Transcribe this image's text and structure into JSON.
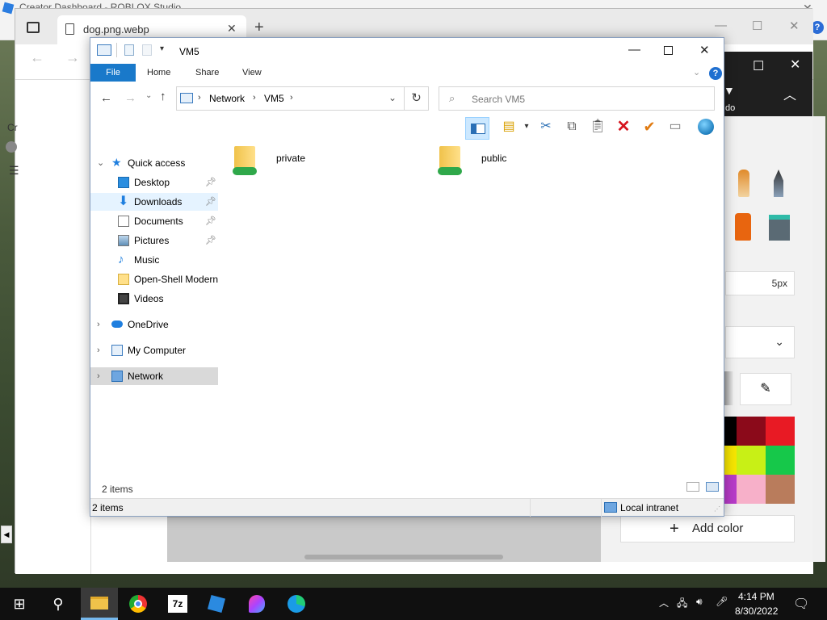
{
  "roblox": {
    "title": "Creator Dashboard - ROBLOX Studio"
  },
  "browser": {
    "tab_title": "dog.png.webp",
    "tab_close": "✕",
    "new_tab": "+",
    "left_text_1": "Cr",
    "minimize": "—",
    "maximize": "☐",
    "close": "✕"
  },
  "paint": {
    "size_value": "5px",
    "add_color": "Add color",
    "partial_label": "do",
    "palette": [
      "#000000",
      "#8b0a1a",
      "#e81a24",
      "#f7e600",
      "#c8f016",
      "#16c84a",
      "#b83bc9",
      "#f7b0c9",
      "#b97c5c"
    ]
  },
  "explorer": {
    "title": "VM5",
    "ribbon_tabs": {
      "file": "File",
      "home": "Home",
      "share": "Share",
      "view": "View"
    },
    "address": {
      "crumb1": "Network",
      "crumb2": "VM5"
    },
    "search_placeholder": "Search VM5",
    "nav": {
      "quick_access": "Quick access",
      "desktop": "Desktop",
      "downloads": "Downloads",
      "documents": "Documents",
      "pictures": "Pictures",
      "music": "Music",
      "openshell": "Open-Shell Modern",
      "videos": "Videos",
      "onedrive": "OneDrive",
      "mycomputer": "My Computer",
      "network": "Network"
    },
    "folders": [
      {
        "name": "private"
      },
      {
        "name": "public"
      }
    ],
    "status_items_inner": "2 items",
    "status_items": "2 items",
    "status_zone": "Local intranet"
  },
  "taskbar": {
    "time": "4:14 PM",
    "date": "8/30/2022"
  },
  "colors": {
    "accent": "#1979ca",
    "selected": "#cce8ff",
    "nav_selected": "#d9d9d9"
  }
}
